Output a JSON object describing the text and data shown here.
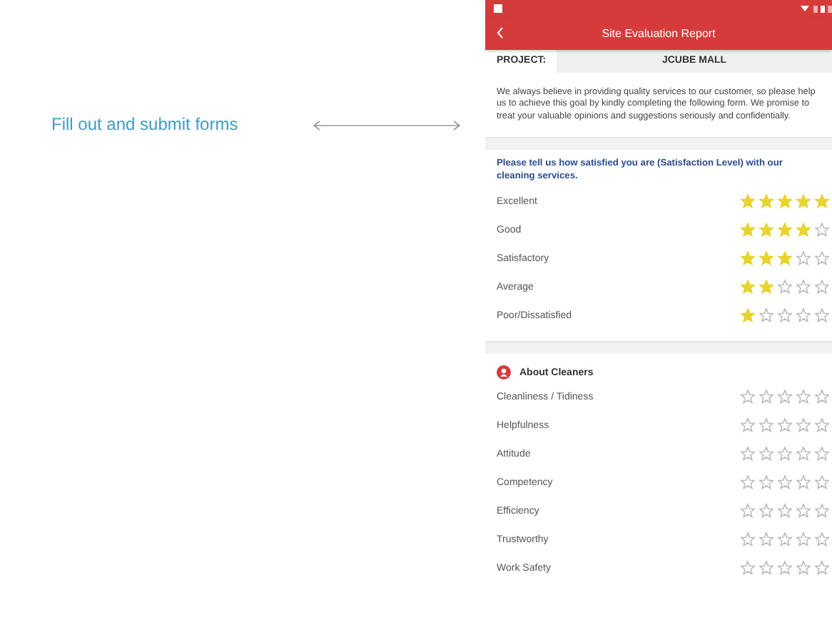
{
  "caption": "Fill out and submit forms",
  "phone": {
    "title": "Site Evaluation Report",
    "project": {
      "label": "PROJECT:",
      "value": "JCUBE MALL"
    },
    "intro": "We always believe in providing quality services to our customer, so please help us to achieve this goal by kindly completing the following form. We promise to treat your valuable opinions and suggestions seriously and confidentially.",
    "satisfaction": {
      "question": "Please tell us how satisfied you are (Satisfaction Level) with our cleaning services.",
      "rows": [
        {
          "label": "Excellent",
          "stars": 5
        },
        {
          "label": "Good",
          "stars": 4
        },
        {
          "label": "Satisfactory",
          "stars": 3
        },
        {
          "label": "Average",
          "stars": 2
        },
        {
          "label": "Poor/Dissatisfied",
          "stars": 1
        }
      ]
    },
    "cleaners": {
      "title": "About Cleaners",
      "rows": [
        {
          "label": "Cleanliness / Tidiness",
          "stars": 0
        },
        {
          "label": "Helpfulness",
          "stars": 0
        },
        {
          "label": "Attitude",
          "stars": 0
        },
        {
          "label": "Competency",
          "stars": 0
        },
        {
          "label": "Efficiency",
          "stars": 0
        },
        {
          "label": "Trustworthy",
          "stars": 0
        },
        {
          "label": "Work Safety",
          "stars": 0
        }
      ]
    }
  }
}
